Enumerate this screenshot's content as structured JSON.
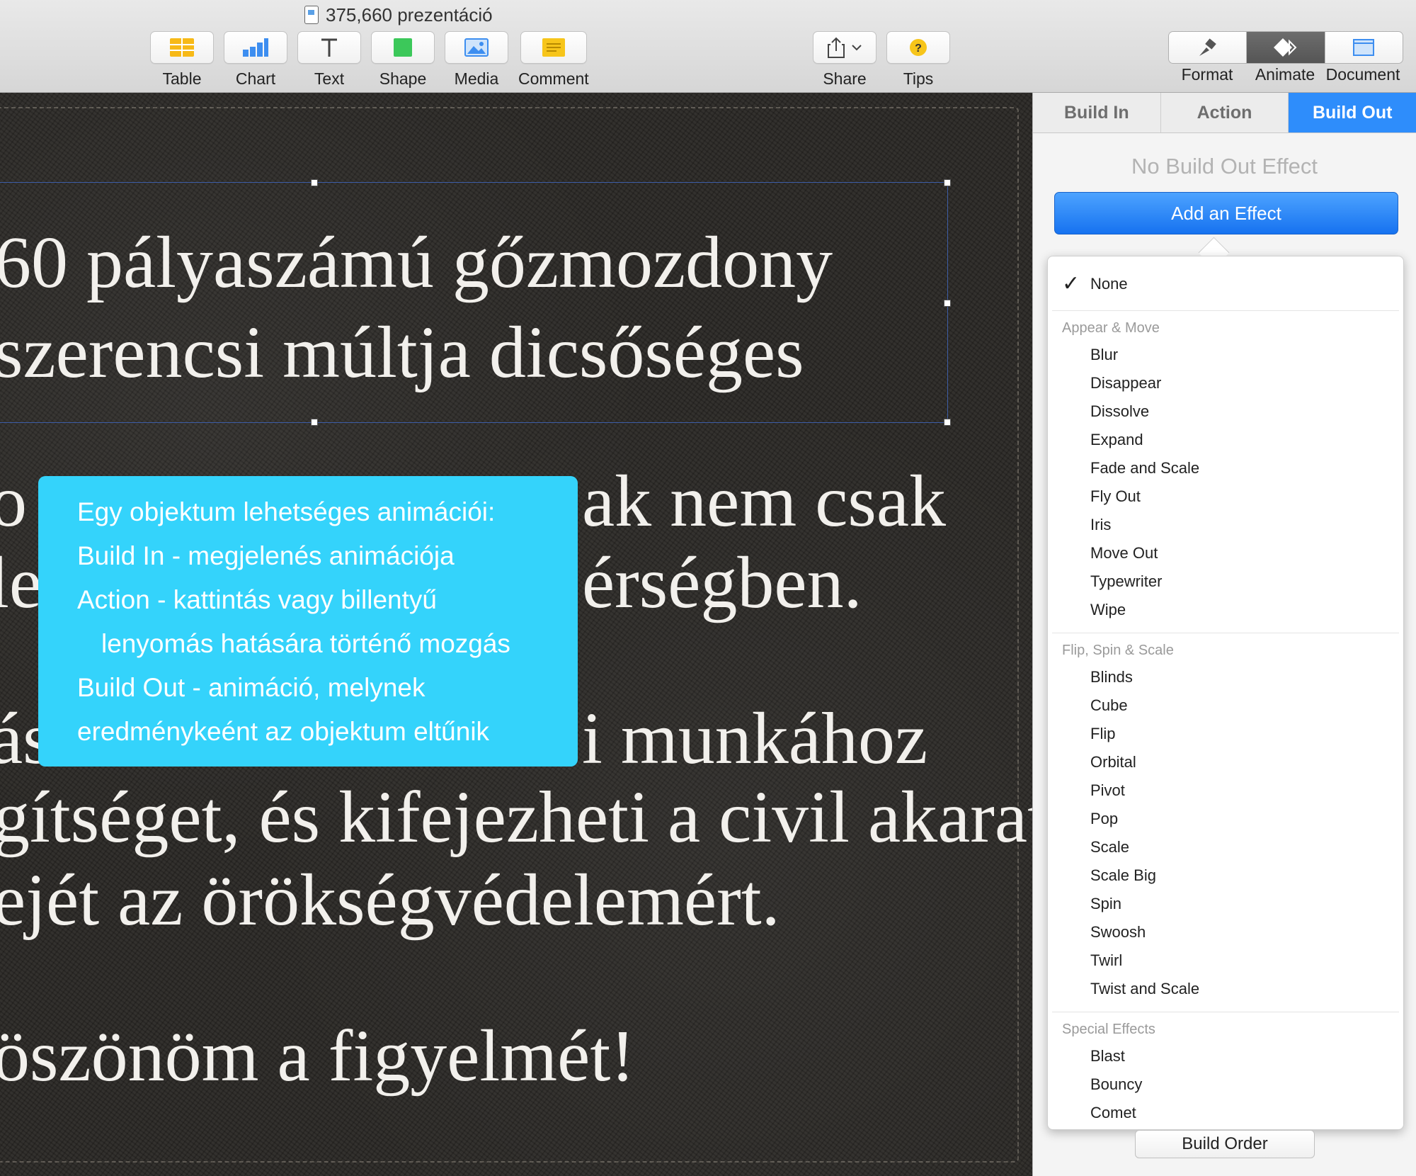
{
  "window": {
    "title": "375,660 prezentáció"
  },
  "toolbar": {
    "table": "Table",
    "chart": "Chart",
    "text": "Text",
    "shape": "Shape",
    "media": "Media",
    "comment": "Comment",
    "share": "Share",
    "tips": "Tips",
    "format": "Format",
    "animate": "Animate",
    "document": "Document"
  },
  "slide": {
    "lines": [
      "60 pályaszámú gőzmozdony",
      "szerencsi múltja dicsőséges",
      "ak nem csak",
      "érségben.",
      "i munkához",
      "gítséget, és kifejezheti a civil akarat",
      "ejét az örökségvédelemért.",
      "öszönöm a figyelmét!"
    ],
    "partial_left": [
      "o",
      "le",
      "ás"
    ]
  },
  "tooltip": {
    "lines": [
      "Egy objektum lehetséges animációi:",
      "Build In - megjelenés animációja",
      "Action - kattintás vagy billentyű",
      "lenyomás hatására történő mozgás",
      "Build Out - animáció, melynek",
      "eredménykeént az objektum eltűnik"
    ]
  },
  "inspector": {
    "tabs": [
      "Build In",
      "Action",
      "Build Out"
    ],
    "active_tab": "Build Out",
    "no_effect": "No Build Out Effect",
    "add_effect": "Add an Effect",
    "build_order": "Build Order",
    "menu": {
      "selected": "None",
      "groups": [
        {
          "title": "Appear & Move",
          "items": [
            "Blur",
            "Disappear",
            "Dissolve",
            "Expand",
            "Fade and Scale",
            "Fly Out",
            "Iris",
            "Move Out",
            "Typewriter",
            "Wipe"
          ]
        },
        {
          "title": "Flip, Spin & Scale",
          "items": [
            "Blinds",
            "Cube",
            "Flip",
            "Orbital",
            "Pivot",
            "Pop",
            "Scale",
            "Scale Big",
            "Spin",
            "Swoosh",
            "Twirl",
            "Twist and Scale"
          ]
        },
        {
          "title": "Special Effects",
          "items": [
            "Blast",
            "Bouncy",
            "Comet"
          ]
        }
      ]
    }
  },
  "colors": {
    "accent": "#2e8dfb",
    "tooltip": "#34d3fb",
    "canvas": "#2b2926"
  }
}
